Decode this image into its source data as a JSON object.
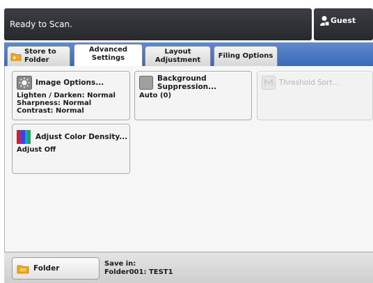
{
  "status": {
    "message": "Ready to Scan."
  },
  "user": {
    "name": "Guest",
    "icon": "user-lock-icon"
  },
  "tabs": [
    {
      "label": "Store to\nFolder",
      "icon": "folder-icon",
      "active": false
    },
    {
      "label": "Advanced\nSettings",
      "active": true
    },
    {
      "label": "Layout\nAdjustment",
      "active": false
    },
    {
      "label": "Filing Options",
      "active": false
    }
  ],
  "options": {
    "image_options": {
      "title": "Image Options...",
      "icon": "image-options-icon",
      "values": [
        "Lighten / Darken: Normal",
        "Sharpness: Normal",
        "Contrast: Normal"
      ]
    },
    "background_suppression": {
      "title": "Background\nSuppression...",
      "icon": "background-suppression-icon",
      "value": "Auto (0)"
    },
    "threshold_sort": {
      "title": "Threshold Sort...",
      "icon": "threshold-sort-icon",
      "enabled": false
    },
    "adjust_color_density": {
      "title": "Adjust Color Density...",
      "icon": "color-density-icon",
      "value": "Adjust Off"
    }
  },
  "bottom": {
    "folder_button": "Folder",
    "folder_icon": "folder-icon",
    "save_in_label": "Save in:",
    "save_in_value": "Folder001: TEST1"
  },
  "colors": {
    "tab_strip": "#4a74c2",
    "status_bar": "#2f3136",
    "folder_icon": "#f0a820"
  }
}
